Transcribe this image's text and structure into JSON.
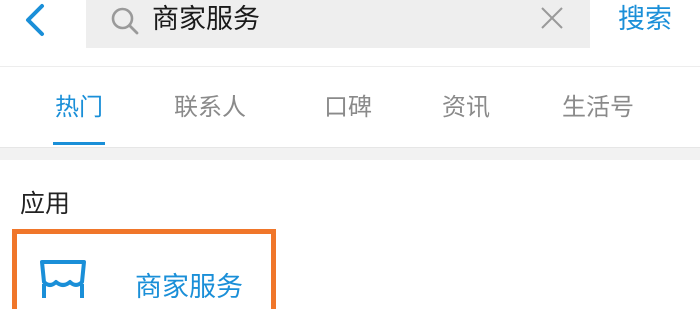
{
  "header": {
    "back_icon": "chevron-left-icon",
    "search": {
      "icon": "search-icon",
      "value": "商家服务",
      "clear_icon": "close-icon"
    },
    "search_button_label": "搜索"
  },
  "tabs": [
    {
      "label": "热门",
      "active": true
    },
    {
      "label": "联系人",
      "active": false
    },
    {
      "label": "口碑",
      "active": false
    },
    {
      "label": "资讯",
      "active": false
    },
    {
      "label": "生活号",
      "active": false
    }
  ],
  "section": {
    "title": "应用",
    "items": [
      {
        "name": "商家服务",
        "icon": "shop-icon"
      }
    ]
  },
  "colors": {
    "accent": "#1a8fd8",
    "highlight_border": "#f0762a",
    "search_bg": "#eeeeee",
    "tab_inactive": "#8a8a8a"
  }
}
